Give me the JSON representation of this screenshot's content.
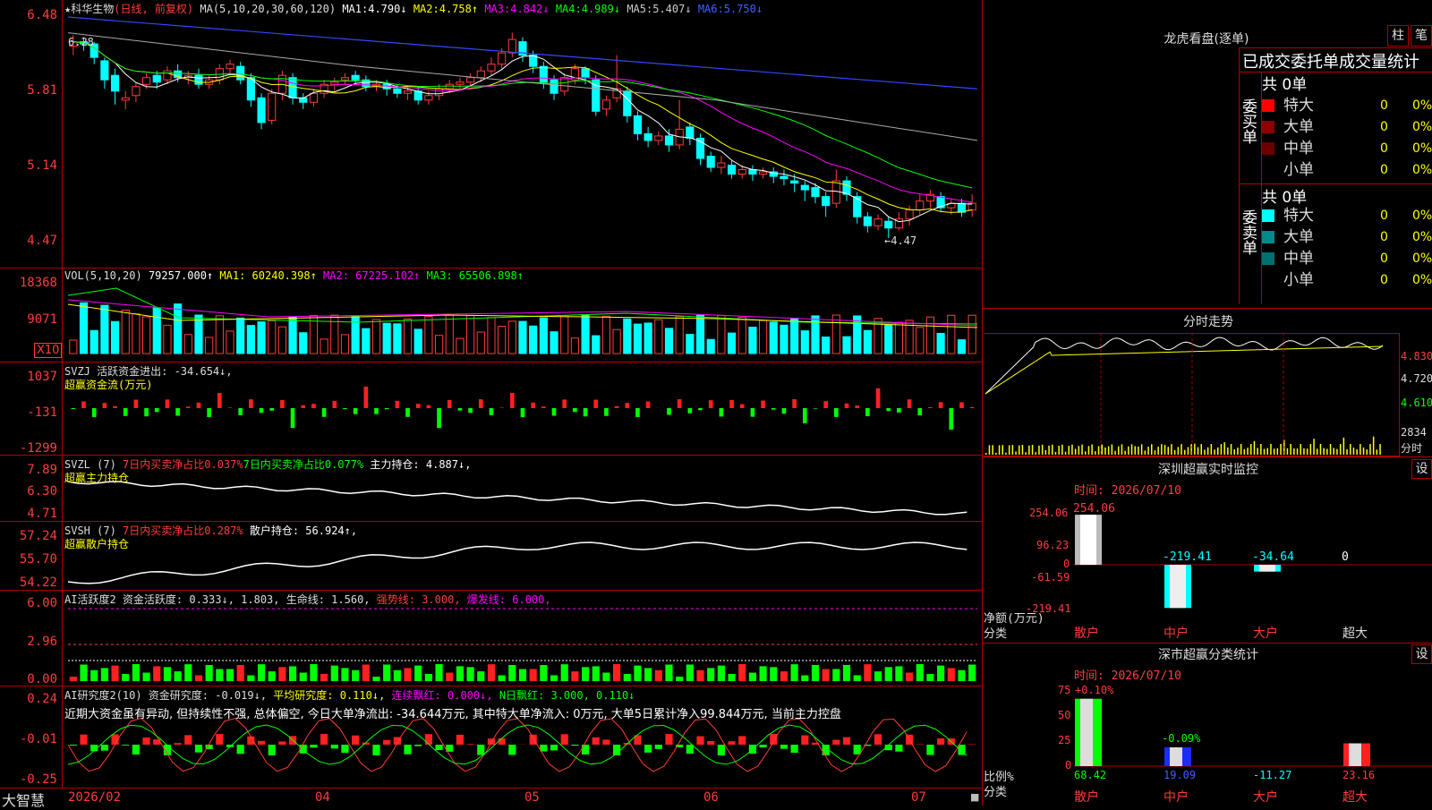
{
  "chart_header": {
    "stock": "★科华生物",
    "period": "(日线, 前复权)",
    "ma_params": "MA(5,10,20,30,60,120)",
    "ma1_label": "MA1:",
    "ma1_value": "4.790↓",
    "ma2_label": "MA2:",
    "ma2_value": "4.758↑",
    "ma3_label": "MA3:",
    "ma3_value": "4.842↓",
    "ma4_label": "MA4:",
    "ma4_value": "4.989↓",
    "ma5_label": "MA5:",
    "ma5_value": "5.407↓",
    "ma6_label": "MA6:",
    "ma6_value": "5.750↓"
  },
  "price_panel": {
    "ticks": [
      "6.48",
      "5.81",
      "5.14",
      "4.47"
    ],
    "high_mark": "6.28",
    "low_mark": "←4.47",
    "candles": [
      [
        6.18,
        6.22,
        6.28,
        6.1
      ],
      [
        6.22,
        6.2,
        6.26,
        6.14
      ],
      [
        6.2,
        6.08,
        6.22,
        6.02
      ],
      [
        6.05,
        5.88,
        6.08,
        5.8
      ],
      [
        5.92,
        5.78,
        5.98,
        5.66
      ],
      [
        5.7,
        5.72,
        5.78,
        5.62
      ],
      [
        5.74,
        5.82,
        5.86,
        5.68
      ],
      [
        5.84,
        5.9,
        5.94,
        5.8
      ],
      [
        5.92,
        5.86,
        5.96,
        5.8
      ],
      [
        5.88,
        5.96,
        6.0,
        5.84
      ],
      [
        5.96,
        5.9,
        6.02,
        5.86
      ],
      [
        5.9,
        5.92,
        5.96,
        5.84
      ],
      [
        5.92,
        5.84,
        5.98,
        5.8
      ],
      [
        5.84,
        5.88,
        5.92,
        5.8
      ],
      [
        5.88,
        5.98,
        6.02,
        5.84
      ],
      [
        5.98,
        6.02,
        6.06,
        5.92
      ],
      [
        6.0,
        5.88,
        6.04,
        5.84
      ],
      [
        5.9,
        5.7,
        5.94,
        5.64
      ],
      [
        5.72,
        5.5,
        5.76,
        5.44
      ],
      [
        5.52,
        5.76,
        5.8,
        5.48
      ],
      [
        5.76,
        5.92,
        5.96,
        5.7
      ],
      [
        5.9,
        5.72,
        5.94,
        5.66
      ],
      [
        5.72,
        5.68,
        5.76,
        5.62
      ],
      [
        5.68,
        5.76,
        5.8,
        5.64
      ],
      [
        5.76,
        5.84,
        5.88,
        5.72
      ],
      [
        5.84,
        5.86,
        5.9,
        5.78
      ],
      [
        5.88,
        5.9,
        5.94,
        5.84
      ],
      [
        5.92,
        5.88,
        5.96,
        5.84
      ],
      [
        5.88,
        5.82,
        5.92,
        5.78
      ],
      [
        5.82,
        5.84,
        5.88,
        5.78
      ],
      [
        5.84,
        5.8,
        5.88,
        5.74
      ],
      [
        5.8,
        5.76,
        5.84,
        5.72
      ],
      [
        5.76,
        5.78,
        5.82,
        5.7
      ],
      [
        5.78,
        5.7,
        5.82,
        5.66
      ],
      [
        5.7,
        5.74,
        5.78,
        5.66
      ],
      [
        5.74,
        5.8,
        5.84,
        5.7
      ],
      [
        5.8,
        5.84,
        5.88,
        5.76
      ],
      [
        5.84,
        5.86,
        5.9,
        5.8
      ],
      [
        5.86,
        5.9,
        5.94,
        5.82
      ],
      [
        5.9,
        5.96,
        6.0,
        5.86
      ],
      [
        5.96,
        6.02,
        6.08,
        5.92
      ],
      [
        6.02,
        6.12,
        6.16,
        5.98
      ],
      [
        6.12,
        6.24,
        6.3,
        6.08
      ],
      [
        6.22,
        6.1,
        6.26,
        6.04
      ],
      [
        6.1,
        6.0,
        6.14,
        5.94
      ],
      [
        6.0,
        5.86,
        6.04,
        5.8
      ],
      [
        5.88,
        5.76,
        5.92,
        5.7
      ],
      [
        5.78,
        5.9,
        5.94,
        5.74
      ],
      [
        5.88,
        5.98,
        6.02,
        5.84
      ],
      [
        5.98,
        5.9,
        6.0,
        5.84
      ],
      [
        5.88,
        5.6,
        5.92,
        5.56
      ],
      [
        5.62,
        5.7,
        5.74,
        5.56
      ],
      [
        5.72,
        5.8,
        6.1,
        5.68
      ],
      [
        5.78,
        5.56,
        5.82,
        5.5
      ],
      [
        5.56,
        5.4,
        5.6,
        5.34
      ],
      [
        5.4,
        5.34,
        5.46,
        5.28
      ],
      [
        5.34,
        5.38,
        5.42,
        5.3
      ],
      [
        5.38,
        5.3,
        5.44,
        5.24
      ],
      [
        5.3,
        5.44,
        5.7,
        5.26
      ],
      [
        5.46,
        5.36,
        5.5,
        5.3
      ],
      [
        5.36,
        5.18,
        5.4,
        5.12
      ],
      [
        5.2,
        5.1,
        5.24,
        5.06
      ],
      [
        5.1,
        5.14,
        5.2,
        5.04
      ],
      [
        5.12,
        5.04,
        5.16,
        5.0
      ],
      [
        5.04,
        5.08,
        5.12,
        5.0
      ],
      [
        5.08,
        5.04,
        5.12,
        4.98
      ],
      [
        5.04,
        5.06,
        5.1,
        5.0
      ],
      [
        5.06,
        5.02,
        5.1,
        4.96
      ],
      [
        5.02,
        5.0,
        5.08,
        4.94
      ],
      [
        4.98,
        4.96,
        5.04,
        4.88
      ],
      [
        4.94,
        4.9,
        4.98,
        4.8
      ],
      [
        4.92,
        4.84,
        4.96,
        4.78
      ],
      [
        4.84,
        4.76,
        4.88,
        4.66
      ],
      [
        4.78,
        4.98,
        5.08,
        4.74
      ],
      [
        4.98,
        4.86,
        5.02,
        4.8
      ],
      [
        4.84,
        4.66,
        4.88,
        4.6
      ],
      [
        4.66,
        4.58,
        4.7,
        4.52
      ],
      [
        4.58,
        4.64,
        4.68,
        4.54
      ],
      [
        4.62,
        4.56,
        4.66,
        4.47
      ],
      [
        4.56,
        4.64,
        4.7,
        4.54
      ],
      [
        4.64,
        4.72,
        4.76,
        4.58
      ],
      [
        4.72,
        4.8,
        4.86,
        4.68
      ],
      [
        4.8,
        4.86,
        4.9,
        4.74
      ],
      [
        4.84,
        4.74,
        4.88,
        4.7
      ],
      [
        4.74,
        4.78,
        4.82,
        4.68
      ],
      [
        4.78,
        4.7,
        4.82,
        4.66
      ],
      [
        4.72,
        4.78,
        4.86,
        4.66
      ]
    ]
  },
  "vol_panel": {
    "label": "VOL(5,10,20)",
    "value": "79257.000↑",
    "ma1": "MA1: 60240.398↑",
    "ma2": "MA2: 67225.102↑",
    "ma3": "MA3: 65506.898↑",
    "ticks": [
      "18368",
      "9071"
    ],
    "unit": "X10"
  },
  "svzj_panel": {
    "label": "SVZJ  活跃资金进出: -34.654↓,",
    "sublabel": "超赢资金流(万元)",
    "ticks": [
      "1037",
      "-131",
      "-1299"
    ]
  },
  "svzl_panel": {
    "label": "SVZL (7)",
    "p1": "7日内买卖净占比0.037%",
    "p2": "7日内买卖净占比0.077%",
    "p3": "主力持仓: 4.887↓,",
    "sublabel": "超赢主力持仓",
    "ticks": [
      "7.89",
      "6.30",
      "4.71"
    ]
  },
  "svsh_panel": {
    "label": "SVSH (7)",
    "p1": "7日内买卖净占比0.287%",
    "p2": "散户持仓: 56.924↑,",
    "sublabel": "超赢散户持仓",
    "ticks": [
      "57.24",
      "55.70",
      "54.22"
    ]
  },
  "ai2_panel": {
    "label": "AI活跃度2 资金活跃度: 0.333↓, 1.803, 生命线: 1.560,",
    "strong": "强势线: 3.000,",
    "burst": "爆发线: 6.000,",
    "ticks": [
      "6.00",
      "2.96",
      "0.00"
    ]
  },
  "ai_research_panel": {
    "label": "AI研究度2(10) 资金研究度: -0.019↓,",
    "avg": "平均研究度: 0.110↓,",
    "cont": "连续飘红: 0.000↓,",
    "nday": "N日飘红: 3.000, 0.110↓",
    "desc": "近期大资金虽有异动, 但持续性不强, 总体偏空, 今日大单净流出: -34.644万元, 其中特大单净流入: 0万元, 大单5日累计净入99.844万元, 当前主力控盘",
    "ticks": [
      "0.24",
      "-0.01",
      "-0.25"
    ]
  },
  "x_axis": {
    "labels": [
      "2026/02",
      "04",
      "05",
      "06",
      "07"
    ],
    "brand": "大智慧"
  },
  "right_panel": {
    "longhu_title": "龙虎看盘(逐单)",
    "btn_bar": "柱",
    "btn_pen": "笔",
    "order_header": "已成交委托单成交量统计",
    "buy_group": "委买单",
    "sell_group": "委卖单",
    "buy_total": "共 0单",
    "sell_total": "共 0单",
    "buy_rows": [
      {
        "name": "特大",
        "vol": "0",
        "pct": "0%",
        "color": "#ff0000"
      },
      {
        "name": "大单",
        "vol": "0",
        "pct": "0%",
        "color": "#8b0000"
      },
      {
        "name": "中单",
        "vol": "0",
        "pct": "0%",
        "color": "#6a0000"
      },
      {
        "name": "小单",
        "vol": "0",
        "pct": "0%",
        "color": ""
      }
    ],
    "sell_rows": [
      {
        "name": "特大",
        "vol": "0",
        "pct": "0%",
        "color": "#00ffff"
      },
      {
        "name": "大单",
        "vol": "0",
        "pct": "0%",
        "color": "#008b8b"
      },
      {
        "name": "中单",
        "vol": "0",
        "pct": "0%",
        "color": "#007070"
      },
      {
        "name": "小单",
        "vol": "0",
        "pct": "0%",
        "color": ""
      }
    ],
    "intraday_title": "分时走势",
    "intraday_ticks": [
      "4.830",
      "4.720",
      "4.610"
    ],
    "intraday_vol_tick": "2834",
    "intraday_vol_unit": "分时",
    "sz_monitor_title": "深圳超赢实时监控",
    "sz_monitor_btn": "设",
    "sz_time": "时间: 2026/07/10",
    "sz_ticks": [
      "254.06",
      "96.23",
      "0",
      "-61.59",
      "-219.41"
    ],
    "sz_values": [
      "254.06",
      "-219.41",
      "-34.64",
      "0"
    ],
    "sz_axis_label1": "净额(万元)",
    "sz_axis_label2": "分类",
    "sz_cats": [
      "散户",
      "中户",
      "大户",
      "超大"
    ],
    "sc_title": "深市超赢分类统计",
    "sc_btn": "设",
    "sc_time": "时间: 2026/07/10",
    "sc_ticks": [
      "75",
      "50",
      "25",
      "0"
    ],
    "sc_top1": "+0.10%",
    "sc_top2": "-0.09%",
    "sc_values": [
      "68.42",
      "19.09",
      "-11.27",
      "23.16"
    ],
    "sc_axis_label1": "比例%",
    "sc_axis_label2": "分类",
    "sc_cats": [
      "散户",
      "中户",
      "大户",
      "超大"
    ]
  },
  "chart_data": [
    {
      "type": "bar",
      "title": "深圳超赢实时监控",
      "categories": [
        "散户",
        "中户",
        "大户",
        "超大"
      ],
      "values": [
        254.06,
        -219.41,
        -34.64,
        0
      ],
      "ylabel": "净额(万元)",
      "ylim": [
        -219.41,
        254.06
      ]
    },
    {
      "type": "bar",
      "title": "深市超赢分类统计",
      "categories": [
        "散户",
        "中户",
        "大户",
        "超大"
      ],
      "values": [
        68.42,
        19.09,
        -11.27,
        23.16
      ],
      "ylabel": "比例%",
      "ylim": [
        0,
        75
      ]
    }
  ]
}
